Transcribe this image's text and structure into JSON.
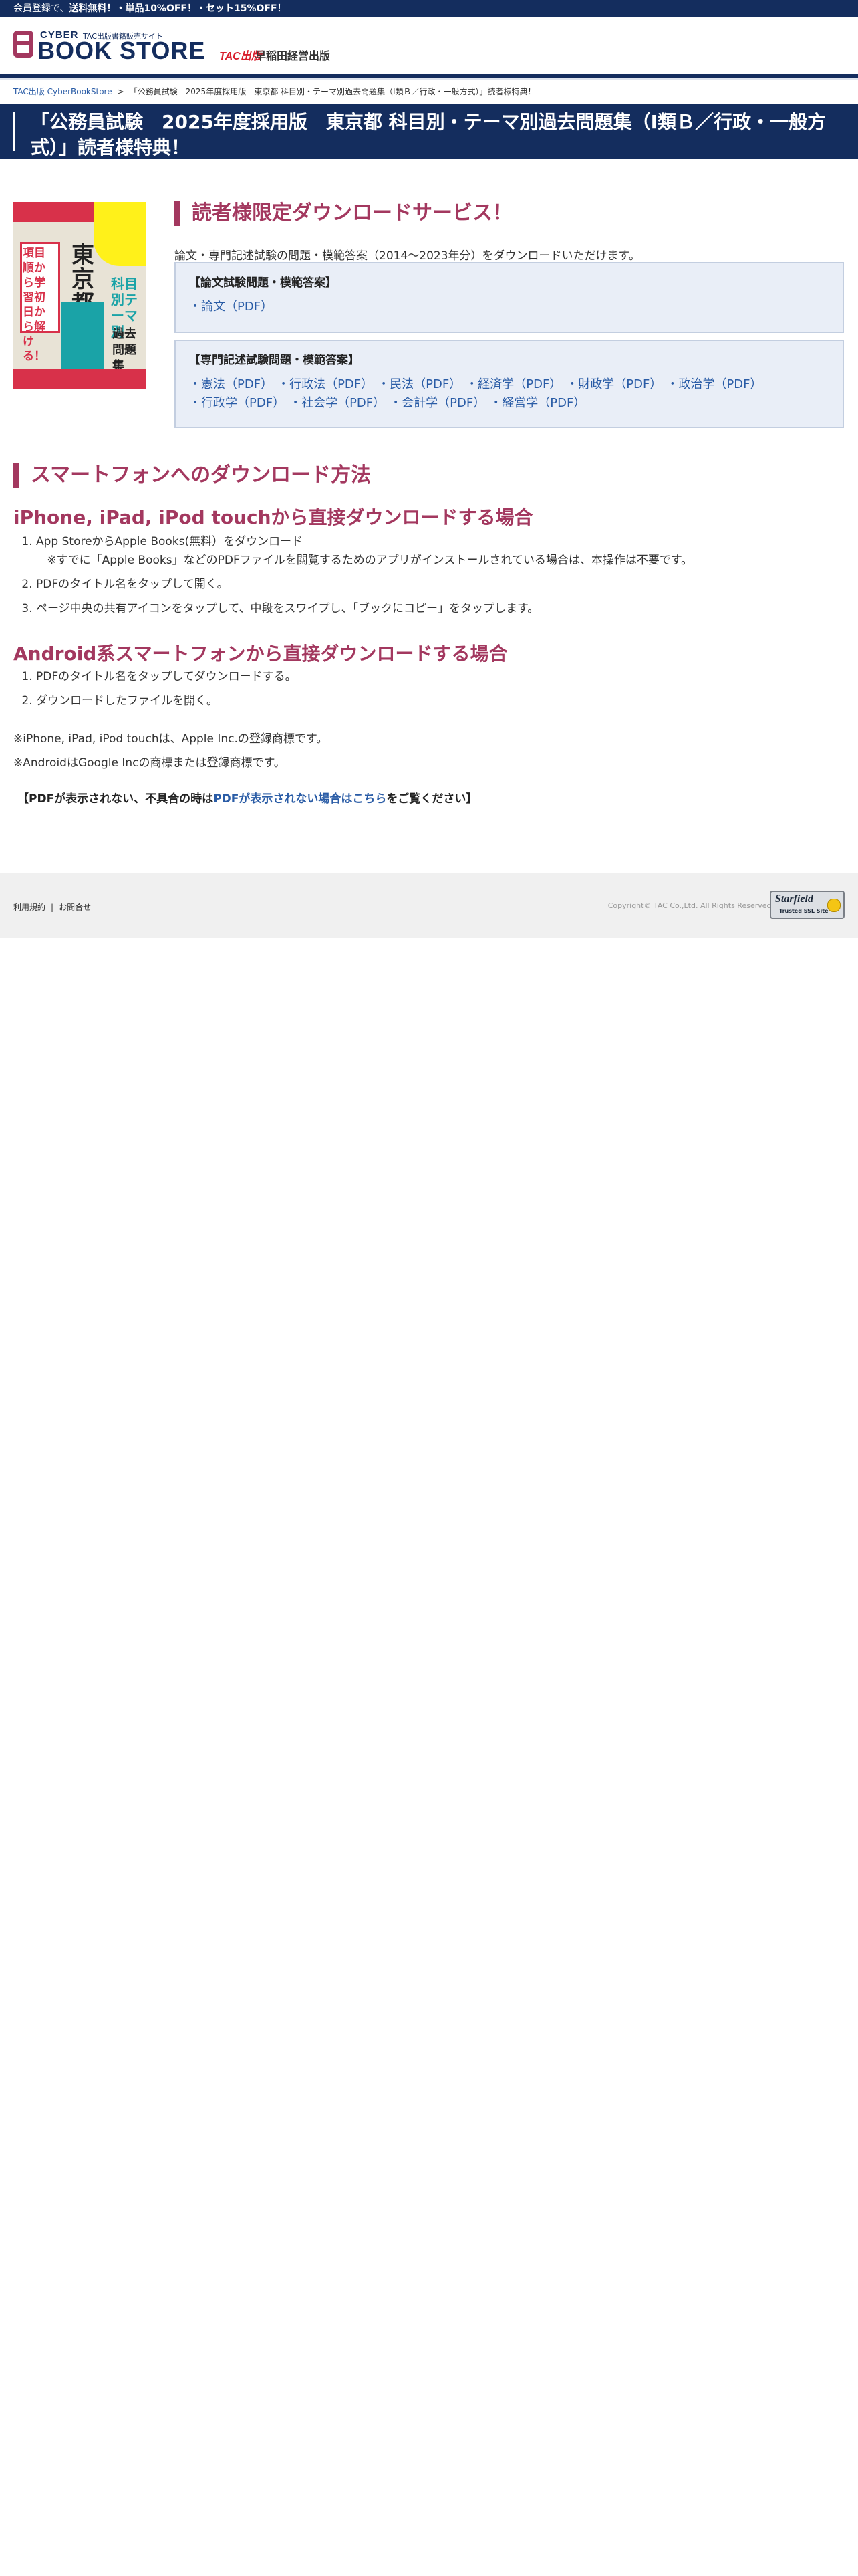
{
  "promo": {
    "prefix": "会員登録で、",
    "highlight": "送料無料！・単品10%OFF！・セット15%OFF！"
  },
  "header": {
    "logo_cyber": "CYBER",
    "logo_subtitle": "TAC出版書籍販売サイト",
    "logo_main": "BOOK STORE",
    "publisher_tac": "TAC出版",
    "publisher_waseda": "早稲田経営出版"
  },
  "breadcrumb": {
    "home": "TAC出版 CyberBookStore",
    "separator": ">",
    "current": "「公務員試験　2025年度採用版　東京都 科目別・テーマ別過去問題集（I類Ｂ／行政・一般方式）」読者様特典！"
  },
  "page_title": "「公務員試験　2025年度採用版　東京都 科目別・テーマ別過去問題集（I類Ｂ／行政・一般方式）」読者様特典！",
  "book_cover": {
    "tokyo": "東京都",
    "tagline": "項目順から学習初日から解ける！",
    "subject": "科目別テーマ別",
    "collection": "過去問題集"
  },
  "download": {
    "heading": "読者様限定ダウンロードサービス！",
    "intro": "論文・専門記述試験の問題・模範答案（2014〜2023年分）をダウンロードいただけます。",
    "essay_box": {
      "title": "【論文試験問題・模範答案】",
      "links": [
        "・論文（PDF）"
      ]
    },
    "specialty_box": {
      "title": "【専門記述試験問題・模範答案】",
      "links": [
        "・憲法（PDF）",
        "・行政法（PDF）",
        "・民法（PDF）",
        "・経済学（PDF）",
        "・財政学（PDF）",
        "・政治学（PDF）",
        "・行政学（PDF）",
        "・社会学（PDF）",
        "・会計学（PDF）",
        "・経営学（PDF）"
      ]
    }
  },
  "smartphone": {
    "heading": "スマートフォンへのダウンロード方法",
    "ios": {
      "heading": "iPhone, iPad, iPod touchから直接ダウンロードする場合",
      "steps": [
        "App StoreからApple Books(無料）をダウンロード",
        "PDFのタイトル名をタップして開く。",
        "ページ中央の共有アイコンをタップして、中段をスワイプし、「ブックにコピー」をタップします。"
      ],
      "step1_note": "※すでに「Apple Books」などのPDFファイルを閲覧するためのアプリがインストールされている場合は、本操作は不要です。"
    },
    "android": {
      "heading": "Android系スマートフォンから直接ダウンロードする場合",
      "steps": [
        "PDFのタイトル名をタップしてダウンロードする。",
        "ダウンロードしたファイルを開く。"
      ]
    },
    "trademark_apple": "※iPhone, iPad, iPod touchは、Apple Inc.の登録商標です。",
    "trademark_android": "※AndroidはGoogle Incの商標または登録商標です。",
    "pdf_notice_prefix": "【PDFが表示されない、不具合の時は",
    "pdf_notice_link": "PDFが表示されない場合はこちら",
    "pdf_notice_suffix": "をご覧ください】"
  },
  "footer": {
    "terms": "利用規約",
    "separator": "|",
    "contact": "お問合せ",
    "copyright": "Copyright© TAC Co.,Ltd. All Rights Reserved.",
    "seal_name": "Starfield",
    "seal_sub": "Trusted SSL Site"
  }
}
